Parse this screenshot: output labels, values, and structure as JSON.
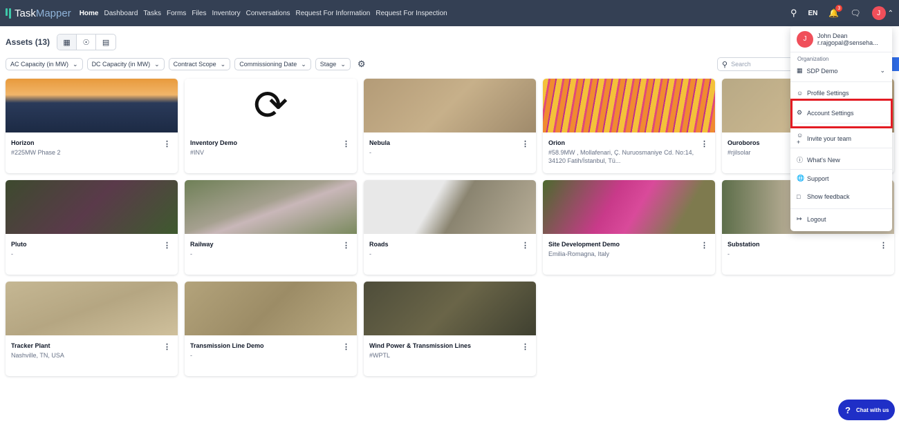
{
  "nav": {
    "brand_a": "Task",
    "brand_b": "Mapper",
    "links": [
      "Home",
      "Dashboard",
      "Tasks",
      "Forms",
      "Files",
      "Inventory",
      "Conversations",
      "Request For Information",
      "Request For Inspection"
    ],
    "language": "EN",
    "notification_count": "3",
    "avatar_initial": "J"
  },
  "page": {
    "title": "Assets (13)",
    "search_placeholder": "Search"
  },
  "filters": [
    "AC Capacity (in MW)",
    "DC Capacity (in MW)",
    "Contract Scope",
    "Commissioning Date",
    "Stage"
  ],
  "assets": [
    {
      "name": "Horizon",
      "sub": "#225MW Phase 2",
      "bg": "linear-gradient(180deg,#e89a3c 0%,#f1b56a 30%,#2a3a5a 45%,#1c2a44 100%)"
    },
    {
      "name": "Inventory Demo",
      "sub": "#INV",
      "bg": "#ffffff"
    },
    {
      "name": "Nebula",
      "sub": "-",
      "bg": "linear-gradient(135deg,#b39b77,#c7b08a 50%,#9f8a6b)"
    },
    {
      "name": "Orion",
      "sub": "#58.9MW , Mollafenari, Ç. Nuruosmaniye Cd. No:14, 34120 Fatih/İstanbul, Tü...",
      "bg": "repeating-linear-gradient(100deg,#f4c13a 0 8px,#e0497a 8px 11px,#f08a30 11px 18px,#c0308a 18px 20px)"
    },
    {
      "name": "Ouroboros",
      "sub": "#rjilsolar",
      "bg": "linear-gradient(135deg,#b8a985,#c9b68f 50%,#a89474)"
    },
    {
      "name": "Pluto",
      "sub": "-",
      "bg": "linear-gradient(135deg,#3d4a2e,#5a3a4a 50%,#3e5a2e)"
    },
    {
      "name": "Railway",
      "sub": "-",
      "bg": "linear-gradient(160deg,#6f8057,#a5a08f 45%,#c9b7b9 55%,#7a8a5e)"
    },
    {
      "name": "Roads",
      "sub": "-",
      "bg": "linear-gradient(120deg,#e8e8e8 0 40%,#8a8470 55%,#b7ad97 100%)"
    },
    {
      "name": "Site Development Demo",
      "sub": "Emilia-Romagna, Italy",
      "bg": "linear-gradient(120deg,#4c6a2e,#c93a8a 40%,#d94a9a 55%,#7e7a4e 80%)"
    },
    {
      "name": "Substation",
      "sub": "-",
      "bg": "linear-gradient(90deg,#5d6e4a,#b8ad95 40%,#c9bda6)"
    },
    {
      "name": "Tracker Plant",
      "sub": "Nashville, TN, USA",
      "bg": "linear-gradient(160deg,#c5b793,#b5a682 50%,#cfc09c)"
    },
    {
      "name": "Transmission Line Demo",
      "sub": "-",
      "bg": "linear-gradient(135deg,#b3a37b,#9c8c66 50%,#b9a981)"
    },
    {
      "name": "Wind Power & Transmission Lines",
      "sub": "#WPTL",
      "bg": "linear-gradient(135deg,#4e4d3a,#6a6548 50%,#3f4030)"
    }
  ],
  "menu": {
    "user_name": "John Dean",
    "user_email": "r.rajgopal@senseha...",
    "org_label": "Organization",
    "org_name": "SDP Demo",
    "items": [
      "Profile Settings",
      "Account Settings",
      "Invite your team",
      "What's New",
      "Support",
      "Show feedback",
      "Logout"
    ]
  },
  "chat": {
    "label": "Chat with us"
  },
  "colors": {
    "nav_bg": "#344054",
    "highlight": "#e31b23",
    "avatar": "#f04f5a",
    "chat": "#1f2fc7"
  }
}
